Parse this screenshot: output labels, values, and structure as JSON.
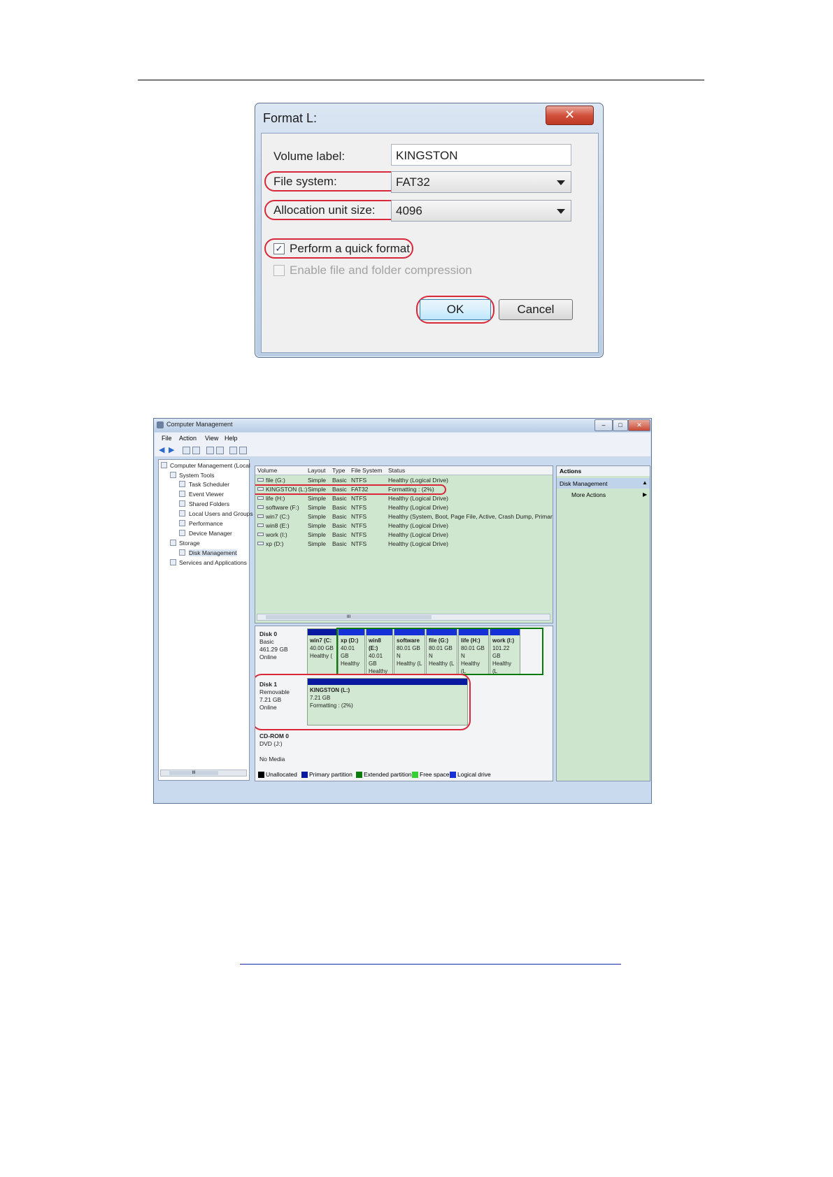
{
  "format_dialog": {
    "title": "Format L:",
    "close_glyph": "✕",
    "volume_label_text": "Volume label:",
    "volume_label_value": "KINGSTON",
    "file_system_text": "File system:",
    "file_system_value": "FAT32",
    "allocation_text": "Allocation unit size:",
    "allocation_value": "4096",
    "quick_format_text": "Perform a quick format",
    "quick_format_checked": true,
    "compression_text": "Enable file and folder compression",
    "compression_checked": false,
    "ok_label": "OK",
    "cancel_label": "Cancel",
    "highlight_color": "#d8283a"
  },
  "computer_management": {
    "title": "Computer Management",
    "menu": [
      "File",
      "Action",
      "View",
      "Help"
    ],
    "window_controls": [
      "–",
      "□",
      "✕"
    ],
    "tree": [
      "Computer Management (Local",
      "System Tools",
      "Task Scheduler",
      "Event Viewer",
      "Shared Folders",
      "Local Users and Groups",
      "Performance",
      "Device Manager",
      "Storage",
      "Disk Management",
      "Services and Applications"
    ],
    "volume_columns": [
      "Volume",
      "Layout",
      "Type",
      "File System",
      "Status"
    ],
    "volumes": [
      [
        "file (G:)",
        "Simple",
        "Basic",
        "NTFS",
        "Healthy (Logical Drive)"
      ],
      [
        "KINGSTON (L:)",
        "Simple",
        "Basic",
        "FAT32",
        "Formatting : (2%)"
      ],
      [
        "life (H:)",
        "Simple",
        "Basic",
        "NTFS",
        "Healthy (Logical Drive)"
      ],
      [
        "software (F:)",
        "Simple",
        "Basic",
        "NTFS",
        "Healthy (Logical Drive)"
      ],
      [
        "win7 (C:)",
        "Simple",
        "Basic",
        "NTFS",
        "Healthy (System, Boot, Page File, Active, Crash Dump, Primary"
      ],
      [
        "win8 (E:)",
        "Simple",
        "Basic",
        "NTFS",
        "Healthy (Logical Drive)"
      ],
      [
        "work (I:)",
        "Simple",
        "Basic",
        "NTFS",
        "Healthy (Logical Drive)"
      ],
      [
        "xp (D:)",
        "Simple",
        "Basic",
        "NTFS",
        "Healthy (Logical Drive)"
      ]
    ],
    "disk0": {
      "name": "Disk 0",
      "type": "Basic",
      "size": "461.29 GB",
      "status": "Online",
      "partitions": [
        {
          "name": "win7 (C:",
          "size": "40.00 GB",
          "status": "Healthy ("
        },
        {
          "name": "xp (D:)",
          "size": "40.01 GB",
          "status": "Healthy"
        },
        {
          "name": "win8 (E:)",
          "size": "40.01 GB",
          "status": "Healthy ("
        },
        {
          "name": "software",
          "size": "80.01 GB N",
          "status": "Healthy (L"
        },
        {
          "name": "file (G:)",
          "size": "80.01 GB N",
          "status": "Healthy (L"
        },
        {
          "name": "life (H:)",
          "size": "80.01 GB N",
          "status": "Healthy (L"
        },
        {
          "name": "work (I:)",
          "size": "101.22 GB",
          "status": "Healthy (L"
        }
      ]
    },
    "disk1": {
      "name": "Disk 1",
      "type": "Removable",
      "size": "7.21 GB",
      "status": "Online",
      "partition_name": "KINGSTON (L:)",
      "partition_size": "7.21 GB",
      "partition_status": "Formatting : (2%)"
    },
    "cdrom": {
      "name": "CD-ROM 0",
      "drive": "DVD (J:)",
      "media": "No Media"
    },
    "legend": [
      "Unallocated",
      "Primary partition",
      "Extended partition",
      "Free space",
      "Logical drive"
    ],
    "legend_colors": [
      "#000000",
      "#0a1aa0",
      "#0a7a0a",
      "#35d035",
      "#1530d6"
    ],
    "actions_header": "Actions",
    "actions_item": "Disk Management",
    "actions_more": "More Actions",
    "scroll_glyph": "III"
  }
}
